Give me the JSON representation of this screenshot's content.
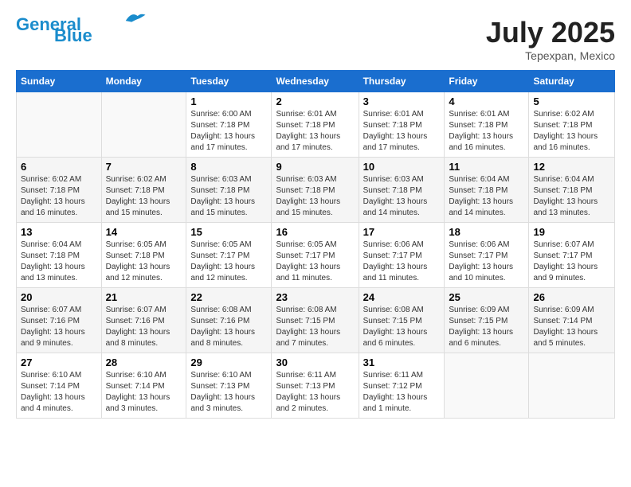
{
  "header": {
    "logo_line1": "General",
    "logo_line2": "Blue",
    "month": "July 2025",
    "location": "Tepexpan, Mexico"
  },
  "days_of_week": [
    "Sunday",
    "Monday",
    "Tuesday",
    "Wednesday",
    "Thursday",
    "Friday",
    "Saturday"
  ],
  "weeks": [
    [
      {
        "day": "",
        "info": ""
      },
      {
        "day": "",
        "info": ""
      },
      {
        "day": "1",
        "info": "Sunrise: 6:00 AM\nSunset: 7:18 PM\nDaylight: 13 hours\nand 17 minutes."
      },
      {
        "day": "2",
        "info": "Sunrise: 6:01 AM\nSunset: 7:18 PM\nDaylight: 13 hours\nand 17 minutes."
      },
      {
        "day": "3",
        "info": "Sunrise: 6:01 AM\nSunset: 7:18 PM\nDaylight: 13 hours\nand 17 minutes."
      },
      {
        "day": "4",
        "info": "Sunrise: 6:01 AM\nSunset: 7:18 PM\nDaylight: 13 hours\nand 16 minutes."
      },
      {
        "day": "5",
        "info": "Sunrise: 6:02 AM\nSunset: 7:18 PM\nDaylight: 13 hours\nand 16 minutes."
      }
    ],
    [
      {
        "day": "6",
        "info": "Sunrise: 6:02 AM\nSunset: 7:18 PM\nDaylight: 13 hours\nand 16 minutes."
      },
      {
        "day": "7",
        "info": "Sunrise: 6:02 AM\nSunset: 7:18 PM\nDaylight: 13 hours\nand 15 minutes."
      },
      {
        "day": "8",
        "info": "Sunrise: 6:03 AM\nSunset: 7:18 PM\nDaylight: 13 hours\nand 15 minutes."
      },
      {
        "day": "9",
        "info": "Sunrise: 6:03 AM\nSunset: 7:18 PM\nDaylight: 13 hours\nand 15 minutes."
      },
      {
        "day": "10",
        "info": "Sunrise: 6:03 AM\nSunset: 7:18 PM\nDaylight: 13 hours\nand 14 minutes."
      },
      {
        "day": "11",
        "info": "Sunrise: 6:04 AM\nSunset: 7:18 PM\nDaylight: 13 hours\nand 14 minutes."
      },
      {
        "day": "12",
        "info": "Sunrise: 6:04 AM\nSunset: 7:18 PM\nDaylight: 13 hours\nand 13 minutes."
      }
    ],
    [
      {
        "day": "13",
        "info": "Sunrise: 6:04 AM\nSunset: 7:18 PM\nDaylight: 13 hours\nand 13 minutes."
      },
      {
        "day": "14",
        "info": "Sunrise: 6:05 AM\nSunset: 7:18 PM\nDaylight: 13 hours\nand 12 minutes."
      },
      {
        "day": "15",
        "info": "Sunrise: 6:05 AM\nSunset: 7:17 PM\nDaylight: 13 hours\nand 12 minutes."
      },
      {
        "day": "16",
        "info": "Sunrise: 6:05 AM\nSunset: 7:17 PM\nDaylight: 13 hours\nand 11 minutes."
      },
      {
        "day": "17",
        "info": "Sunrise: 6:06 AM\nSunset: 7:17 PM\nDaylight: 13 hours\nand 11 minutes."
      },
      {
        "day": "18",
        "info": "Sunrise: 6:06 AM\nSunset: 7:17 PM\nDaylight: 13 hours\nand 10 minutes."
      },
      {
        "day": "19",
        "info": "Sunrise: 6:07 AM\nSunset: 7:17 PM\nDaylight: 13 hours\nand 9 minutes."
      }
    ],
    [
      {
        "day": "20",
        "info": "Sunrise: 6:07 AM\nSunset: 7:16 PM\nDaylight: 13 hours\nand 9 minutes."
      },
      {
        "day": "21",
        "info": "Sunrise: 6:07 AM\nSunset: 7:16 PM\nDaylight: 13 hours\nand 8 minutes."
      },
      {
        "day": "22",
        "info": "Sunrise: 6:08 AM\nSunset: 7:16 PM\nDaylight: 13 hours\nand 8 minutes."
      },
      {
        "day": "23",
        "info": "Sunrise: 6:08 AM\nSunset: 7:15 PM\nDaylight: 13 hours\nand 7 minutes."
      },
      {
        "day": "24",
        "info": "Sunrise: 6:08 AM\nSunset: 7:15 PM\nDaylight: 13 hours\nand 6 minutes."
      },
      {
        "day": "25",
        "info": "Sunrise: 6:09 AM\nSunset: 7:15 PM\nDaylight: 13 hours\nand 6 minutes."
      },
      {
        "day": "26",
        "info": "Sunrise: 6:09 AM\nSunset: 7:14 PM\nDaylight: 13 hours\nand 5 minutes."
      }
    ],
    [
      {
        "day": "27",
        "info": "Sunrise: 6:10 AM\nSunset: 7:14 PM\nDaylight: 13 hours\nand 4 minutes."
      },
      {
        "day": "28",
        "info": "Sunrise: 6:10 AM\nSunset: 7:14 PM\nDaylight: 13 hours\nand 3 minutes."
      },
      {
        "day": "29",
        "info": "Sunrise: 6:10 AM\nSunset: 7:13 PM\nDaylight: 13 hours\nand 3 minutes."
      },
      {
        "day": "30",
        "info": "Sunrise: 6:11 AM\nSunset: 7:13 PM\nDaylight: 13 hours\nand 2 minutes."
      },
      {
        "day": "31",
        "info": "Sunrise: 6:11 AM\nSunset: 7:12 PM\nDaylight: 13 hours\nand 1 minute."
      },
      {
        "day": "",
        "info": ""
      },
      {
        "day": "",
        "info": ""
      }
    ]
  ]
}
